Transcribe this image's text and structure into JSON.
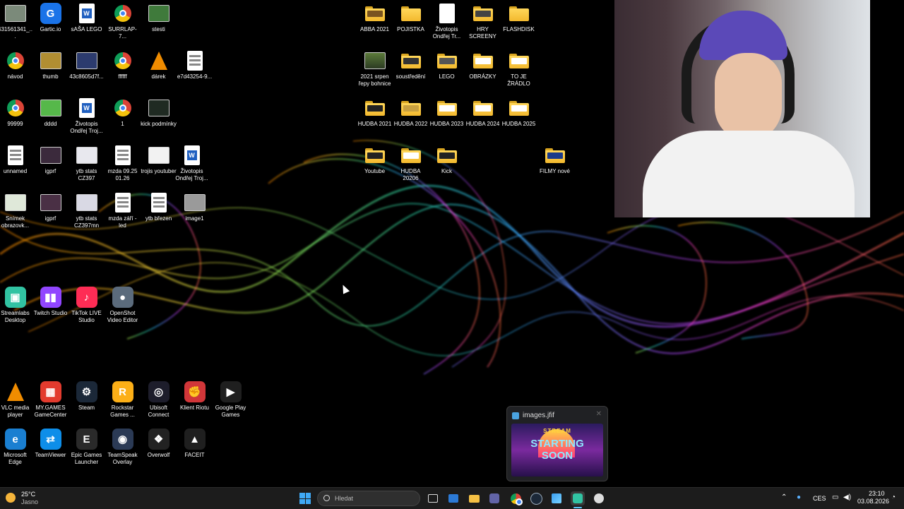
{
  "desktop": {
    "col1": [
      {
        "label": "431561341_...",
        "kind": "photo",
        "color": "#7b8a7a"
      },
      {
        "label": "návod",
        "kind": "chrome"
      },
      {
        "label": "99999",
        "kind": "chrome"
      },
      {
        "label": "unnamed",
        "kind": "file"
      },
      {
        "label": "Snímek obrazovk...",
        "kind": "photo",
        "color": "#dfe8d9"
      },
      {
        "label": "Streamlabs Desktop",
        "kind": "app",
        "color": "#31c3a2",
        "glyph": "▣"
      },
      {
        "label": "VLC media player",
        "kind": "vlc"
      },
      {
        "label": "Microsoft Edge",
        "kind": "app",
        "color": "#1a7fd1",
        "glyph": "e"
      }
    ],
    "col2": [
      {
        "label": "Gartic.io",
        "kind": "app",
        "color": "#1a73e8",
        "glyph": "G"
      },
      {
        "label": "thumb",
        "kind": "photo",
        "color": "#b18e32"
      },
      {
        "label": "dddd",
        "kind": "photo",
        "color": "#56b84a"
      },
      {
        "label": "igprf",
        "kind": "photo",
        "color": "#3b2a3c"
      },
      {
        "label": "igprf",
        "kind": "photo",
        "color": "#4a3045"
      },
      {
        "label": "Twitch Studio",
        "kind": "app",
        "color": "#9146ff",
        "glyph": "▮▮"
      },
      {
        "label": "MY.GAMES GameCenter",
        "kind": "app",
        "color": "#e33b2e",
        "glyph": "▦"
      },
      {
        "label": "TeamViewer",
        "kind": "app",
        "color": "#0e8ee9",
        "glyph": "⇄"
      }
    ],
    "col3": [
      {
        "label": "sAŠA LEGO",
        "kind": "word"
      },
      {
        "label": "43c8605d7f...",
        "kind": "photo",
        "color": "#2c3b6e"
      },
      {
        "label": "Životopis Ondřej Troj...",
        "kind": "word"
      },
      {
        "label": "ytb stats CZ397",
        "kind": "photo",
        "color": "#e8e8ee"
      },
      {
        "label": "ytb stats CZ397mn",
        "kind": "photo",
        "color": "#d9d9e4"
      },
      {
        "label": "TikTok LIVE Studio",
        "kind": "app",
        "color": "#fe2c55",
        "glyph": "♪"
      },
      {
        "label": "Steam",
        "kind": "app",
        "color": "#1b2838",
        "glyph": "⚙"
      },
      {
        "label": "Epic Games Launcher",
        "kind": "app",
        "color": "#2a2a2a",
        "glyph": "E"
      }
    ],
    "col4": [
      {
        "label": "SURRLAP-7...",
        "kind": "chrome"
      },
      {
        "label": "ffffff",
        "kind": "chrome"
      },
      {
        "label": "1",
        "kind": "chrome"
      },
      {
        "label": "mzda 09.25 01.26",
        "kind": "file"
      },
      {
        "label": "mzda září - led",
        "kind": "file"
      },
      {
        "label": "OpenShot Video Editor",
        "kind": "app",
        "color": "#5b6b7c",
        "glyph": "●"
      },
      {
        "label": "Rockstar Games ...",
        "kind": "app",
        "color": "#fcaf17",
        "glyph": "R"
      },
      {
        "label": "TeamSpeak Overlay",
        "kind": "app",
        "color": "#2b3a55",
        "glyph": "◉"
      }
    ],
    "col5": [
      {
        "label": "stesti",
        "kind": "photo",
        "color": "#3f7a3b"
      },
      {
        "label": "dárek",
        "kind": "vlc"
      },
      {
        "label": "kick podmínky",
        "kind": "photo",
        "color": "#1f2a22"
      },
      {
        "label": "trojis youtuber",
        "kind": "photo",
        "color": "#f2f2f2"
      },
      {
        "label": "ytb březen",
        "kind": "file"
      },
      {
        "label": "Ubisoft Connect",
        "kind": "app",
        "color": "#1d1d2b",
        "glyph": "◎"
      },
      {
        "label": "Overwolf",
        "kind": "app",
        "color": "#222",
        "glyph": "❖"
      }
    ],
    "col6": [
      {
        "label": "e7d43254-9...",
        "kind": "file"
      },
      {
        "label": "Životopis Ondřej Troj...",
        "kind": "word"
      },
      {
        "label": "image1",
        "kind": "photo",
        "color": "#9a9a9a"
      },
      {
        "label": "Klient Riotu",
        "kind": "app",
        "color": "#d13639",
        "glyph": "✊"
      },
      {
        "label": "FACEIT",
        "kind": "app",
        "color": "#1f1f1f",
        "glyph": "▲"
      }
    ],
    "col6b": [
      {
        "label": "Google Play Games",
        "kind": "app",
        "color": "#1f1f1f",
        "glyph": "▶"
      }
    ],
    "folders": [
      {
        "label": "ABBA 2021",
        "thumb": "#7a5420"
      },
      {
        "label": "POJISTKA",
        "thumb": ""
      },
      {
        "label": "Životopis Ondřej Tr...",
        "thumb": "doc"
      },
      {
        "label": "HRY SCREENY",
        "thumb": "#444"
      },
      {
        "label": "FLASHDISK",
        "thumb": ""
      },
      {
        "label": "2021 srpen řepy bohnice",
        "thumb": "photo"
      },
      {
        "label": "soustředění",
        "thumb": "#333"
      },
      {
        "label": "LEGO",
        "thumb": "#555"
      },
      {
        "label": "OBRÁZKY",
        "thumb": "#fff"
      },
      {
        "label": "TO JE ŽRÁDLO",
        "thumb": "#fff"
      },
      {
        "label": "HUDBA 2021",
        "thumb": "#222"
      },
      {
        "label": "HUDBA 2022",
        "thumb": "#c8a040"
      },
      {
        "label": "HUDBA 2023",
        "thumb": "#fff"
      },
      {
        "label": "HUDBA 2024",
        "thumb": "#fff"
      },
      {
        "label": "HUDBA 2025",
        "thumb": "#fff"
      },
      {
        "label": "Youtube",
        "thumb": "#222"
      },
      {
        "label": "HUDBA 20206",
        "thumb": "#fff"
      },
      {
        "label": "Kick",
        "thumb": "#222"
      },
      {
        "label": "FILMY nové",
        "thumb": "#1a3a8a"
      }
    ]
  },
  "preview": {
    "title": "images.jfif",
    "line1": "STREAM",
    "line2": "STARTING",
    "line3": "SOON"
  },
  "taskbar": {
    "weather_temp": "25°C",
    "weather_desc": "Jasno",
    "search_placeholder": "Hledat",
    "lang": "CES",
    "time": "23:10",
    "date": "03.08.2026",
    "apps": [
      "Start",
      "Search",
      "Task View",
      "Store",
      "File Explorer",
      "Teams",
      "Chrome",
      "Steam",
      "Snipping",
      "Streamlabs",
      "OBS"
    ]
  }
}
